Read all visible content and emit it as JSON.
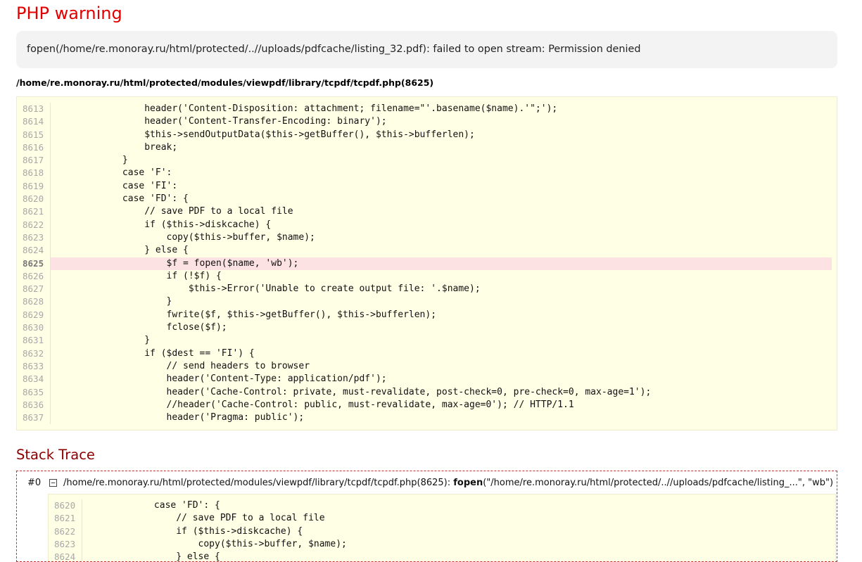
{
  "header": {
    "title": "PHP warning",
    "message": "fopen(/home/re.monoray.ru/html/protected/..//uploads/pdfcache/listing_32.pdf): failed to open stream: Permission denied",
    "file": "/home/re.monoray.ru/html/protected/modules/viewpdf/library/tcpdf/tcpdf.php(8625)"
  },
  "source": {
    "error_line": "8625",
    "lines": [
      {
        "n": "8613",
        "code": "                header('Content-Disposition: attachment; filename=\"'.basename($name).'\";');"
      },
      {
        "n": "8614",
        "code": "                header('Content-Transfer-Encoding: binary');"
      },
      {
        "n": "8615",
        "code": "                $this->sendOutputData($this->getBuffer(), $this->bufferlen);"
      },
      {
        "n": "8616",
        "code": "                break;"
      },
      {
        "n": "8617",
        "code": "            }"
      },
      {
        "n": "8618",
        "code": "            case 'F':"
      },
      {
        "n": "8619",
        "code": "            case 'FI':"
      },
      {
        "n": "8620",
        "code": "            case 'FD': {"
      },
      {
        "n": "8621",
        "code": "                // save PDF to a local file"
      },
      {
        "n": "8622",
        "code": "                if ($this->diskcache) {"
      },
      {
        "n": "8623",
        "code": "                    copy($this->buffer, $name);"
      },
      {
        "n": "8624",
        "code": "                } else {"
      },
      {
        "n": "8625",
        "code": "                    $f = fopen($name, 'wb');"
      },
      {
        "n": "8626",
        "code": "                    if (!$f) {"
      },
      {
        "n": "8627",
        "code": "                        $this->Error('Unable to create output file: '.$name);"
      },
      {
        "n": "8628",
        "code": "                    }"
      },
      {
        "n": "8629",
        "code": "                    fwrite($f, $this->getBuffer(), $this->bufferlen);"
      },
      {
        "n": "8630",
        "code": "                    fclose($f);"
      },
      {
        "n": "8631",
        "code": "                }"
      },
      {
        "n": "8632",
        "code": "                if ($dest == 'FI') {"
      },
      {
        "n": "8633",
        "code": "                    // send headers to browser"
      },
      {
        "n": "8634",
        "code": "                    header('Content-Type: application/pdf');"
      },
      {
        "n": "8635",
        "code": "                    header('Cache-Control: private, must-revalidate, post-check=0, pre-check=0, max-age=1');"
      },
      {
        "n": "8636",
        "code": "                    //header('Cache-Control: public, must-revalidate, max-age=0'); // HTTP/1.1"
      },
      {
        "n": "8637",
        "code": "                    header('Pragma: public');"
      }
    ]
  },
  "stack": {
    "title": "Stack Trace",
    "items": [
      {
        "num": "#0",
        "toggle": "−",
        "path": "/home/re.monoray.ru/html/protected/modules/viewpdf/library/tcpdf/tcpdf.php(8625): ",
        "func": "fopen",
        "args": "(\"/home/re.monoray.ru/html/protected/..//uploads/pdfcache/listing_...\", \"wb\")",
        "lines": [
          {
            "n": "8620",
            "code": "            case 'FD': {"
          },
          {
            "n": "8621",
            "code": "                // save PDF to a local file"
          },
          {
            "n": "8622",
            "code": "                if ($this->diskcache) {"
          },
          {
            "n": "8623",
            "code": "                    copy($this->buffer, $name);"
          },
          {
            "n": "8624",
            "code": "                } else {"
          }
        ]
      }
    ]
  }
}
